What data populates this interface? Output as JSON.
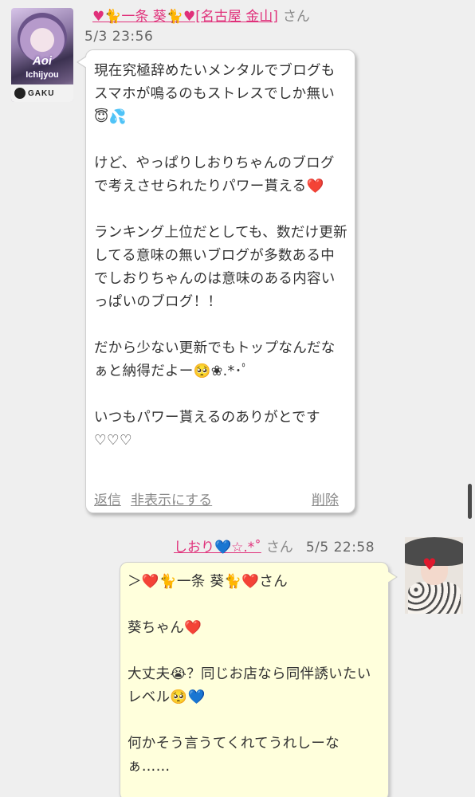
{
  "comments": [
    {
      "author_name": "♥🐈一条 葵🐈♥[名古屋 金山]",
      "honorific": "さん",
      "date": "5/3 23:56",
      "avatar_text_top": "Aoi",
      "avatar_text_bottom": "Ichijyou",
      "avatar_brand": "GAKU",
      "message": "現在究極辞めたいメンタルでブログもスマホが鳴るのもストレスでしか無い😇💦\n\nけど、やっぱりしおりちゃんのブログで考えさせられたりパワー貰える❤️\n\nランキング上位だとしても、数だけ更新してる意味の無いブログが多数ある中でしおりちゃんのは意味のある内容いっぱいのブログ！！\n\nだから少ない更新でもトップなんだなぁと納得だよー🥺❀.*･ﾟ\n\nいつもパワー貰えるのありがとです♡♡♡",
      "actions": {
        "reply": "返信",
        "hide": "非表示にする",
        "delete": "削除"
      }
    },
    {
      "author_name": "しおり💙☆.*˚",
      "honorific": "さん",
      "date": "5/5 22:58",
      "message": "＞❤️🐈一条 葵🐈❤️さん\n\n葵ちゃん❤️\n\n大丈夫😭？同じお店なら同伴誘いたいレベル🥺💙\n\n何かそう言うてくれてうれしーなぁ……"
    }
  ],
  "colors": {
    "author_link": "#e0307a",
    "page_background": "#efefef",
    "own_bubble": "#ffffdc"
  }
}
